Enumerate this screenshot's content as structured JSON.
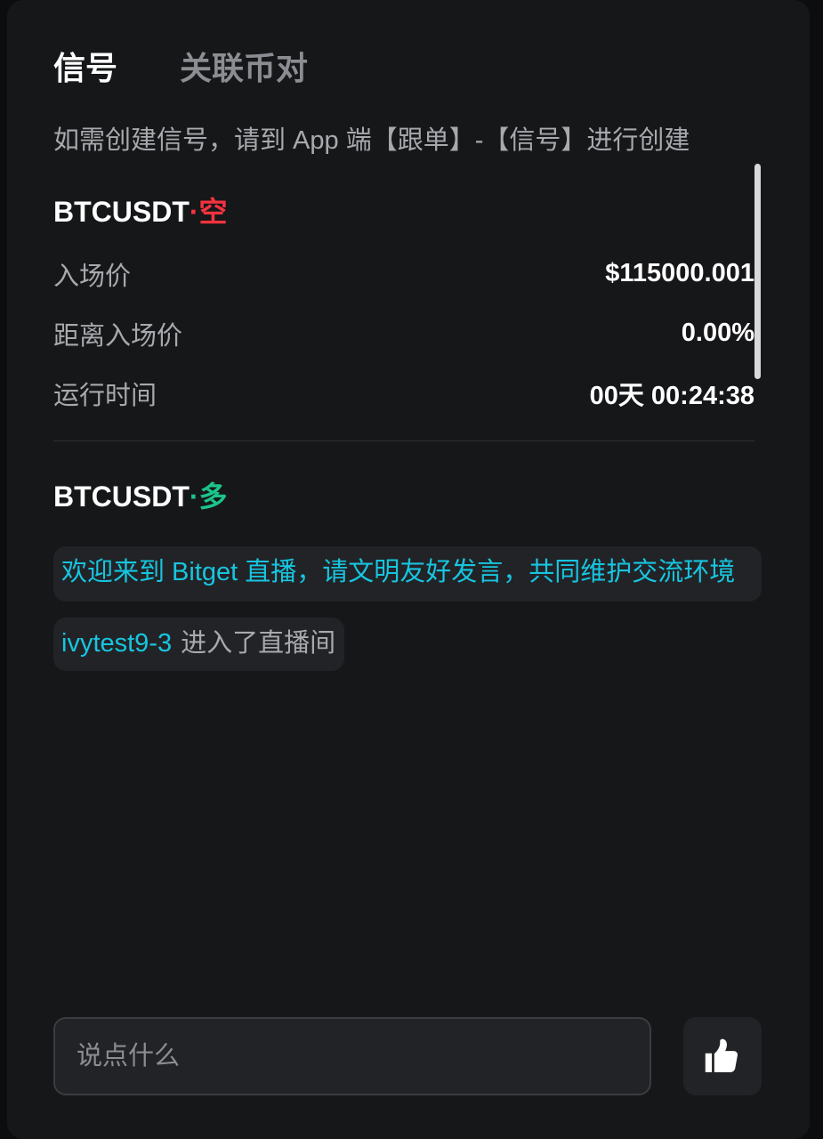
{
  "tabs": [
    {
      "label": "信号",
      "active": true
    },
    {
      "label": "关联币对",
      "active": false
    }
  ],
  "hint": "如需创建信号，请到 App 端【跟单】-【信号】进行创建",
  "signals": [
    {
      "symbol": "BTCUSDT",
      "separator": "·",
      "direction": "空",
      "direction_color": "#f5333f",
      "rows": [
        {
          "label": "入场价",
          "value": "$115000.001"
        },
        {
          "label": "距离入场价",
          "value": "0.00%"
        },
        {
          "label": "运行时间",
          "value": "00天 00:24:38"
        }
      ]
    },
    {
      "symbol": "BTCUSDT",
      "separator": "·",
      "direction": "多",
      "direction_color": "#1bc48a"
    }
  ],
  "chat": {
    "system_message": "欢迎来到 Bitget 直播，请文明友好发言，共同维护交流环境",
    "event": {
      "user": "ivytest9-3",
      "text": "进入了直播间"
    }
  },
  "composer": {
    "placeholder": "说点什么",
    "like_icon": "thumbs-up-icon"
  },
  "colors": {
    "background": "#161719",
    "accent_cyan": "#17c5e0",
    "short_red": "#f5333f",
    "long_green": "#1bc48a"
  }
}
